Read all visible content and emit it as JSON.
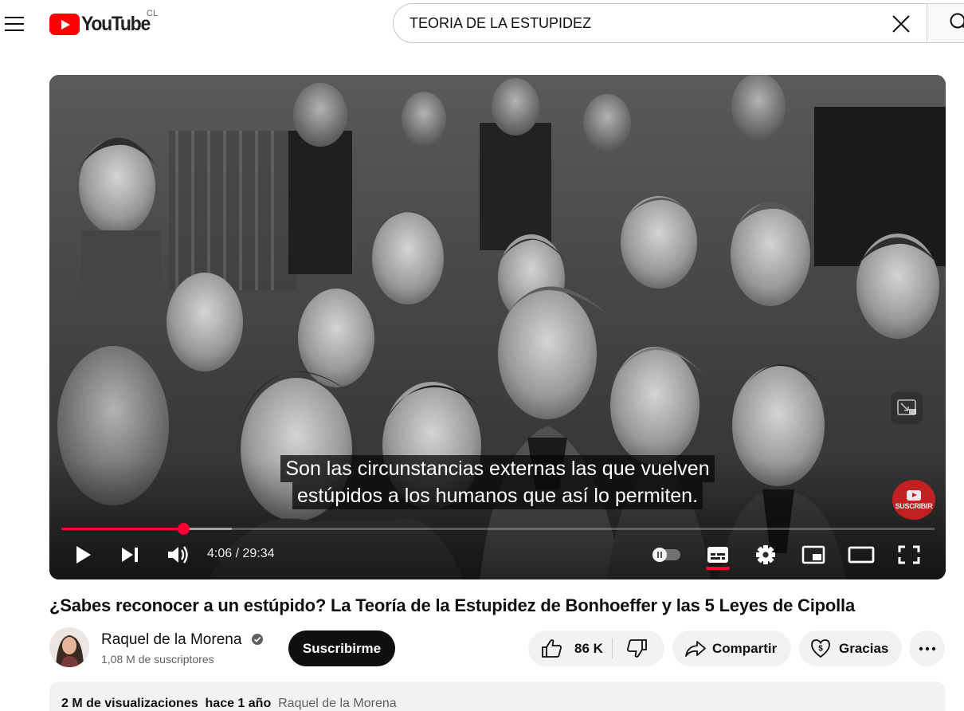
{
  "header": {
    "logo_text": "YouTube",
    "country_code": "CL",
    "search": {
      "value": "TEORIA DE LA ESTUPIDEZ"
    }
  },
  "player": {
    "caption_lines": [
      "Son las circunstancias externas las que vuelven",
      "estúpidos a los humanos que así lo permiten."
    ],
    "subscribe_badge_text": "SUSCRIBIR",
    "time_display": "4:06 / 29:34",
    "current_time": "4:06",
    "duration": "29:34",
    "progress_fraction": 0.14,
    "buffered_fraction": 0.195,
    "accent_color": "#ff0033"
  },
  "video": {
    "title": "¿Sabes reconocer a un estúpido? La Teoría de la Estupidez de Bonhoeffer y las 5 Leyes de Cipolla",
    "channel": {
      "name": "Raquel de la Morena",
      "subscribers": "1,08 M de suscriptores",
      "verified": true
    },
    "actions": {
      "subscribe": "Suscribirme",
      "likes": "86 K",
      "share": "Compartir",
      "thanks": "Gracias"
    },
    "description": {
      "views": "2 M de visualizaciones",
      "date": "hace 1 año",
      "tag": "Raquel de la Morena"
    }
  },
  "icons": [
    "menu-icon",
    "youtube-logo-icon",
    "clear-icon",
    "search-icon",
    "play-icon",
    "next-icon",
    "volume-icon",
    "autoplay-toggle-icon",
    "subtitles-icon",
    "settings-icon",
    "miniplayer-icon",
    "theater-mode-icon",
    "fullscreen-icon",
    "like-icon",
    "dislike-icon",
    "share-icon",
    "thanks-icon",
    "more-icon",
    "verified-icon"
  ]
}
